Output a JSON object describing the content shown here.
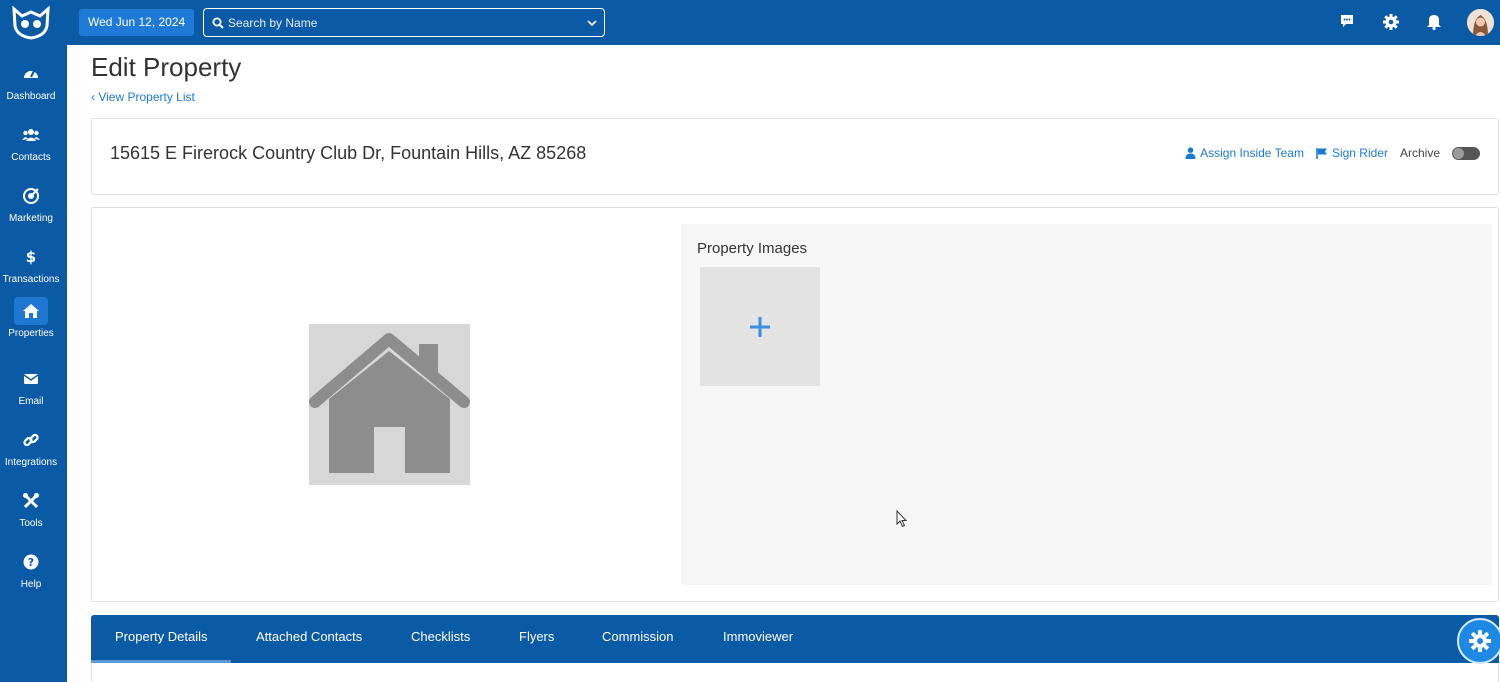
{
  "topbar": {
    "date": "Wed Jun 12, 2024",
    "search_placeholder": "Search by Name"
  },
  "sidebar": {
    "items": [
      {
        "label": "Dashboard",
        "icon": "dashboard-icon"
      },
      {
        "label": "Contacts",
        "icon": "contacts-icon"
      },
      {
        "label": "Marketing",
        "icon": "marketing-icon"
      },
      {
        "label": "Transactions",
        "icon": "dollar-icon"
      },
      {
        "label": "Properties",
        "icon": "home-icon",
        "active": true
      },
      {
        "label": "Email",
        "icon": "envelope-icon"
      },
      {
        "label": "Integrations",
        "icon": "link-icon"
      },
      {
        "label": "Tools",
        "icon": "tools-icon"
      },
      {
        "label": "Help",
        "icon": "help-icon"
      }
    ]
  },
  "page": {
    "title": "Edit Property",
    "back_link": "View Property List"
  },
  "property": {
    "address": "15615 E Firerock Country Club Dr, Fountain Hills, AZ 85268",
    "actions": {
      "assign_inside_team": "Assign Inside Team",
      "sign_rider": "Sign Rider",
      "archive": "Archive"
    },
    "archive_enabled": false
  },
  "images": {
    "title": "Property Images",
    "add_symbol": "+"
  },
  "tabs": [
    {
      "label": "Property Details",
      "active": true
    },
    {
      "label": "Attached Contacts"
    },
    {
      "label": "Checklists"
    },
    {
      "label": "Flyers"
    },
    {
      "label": "Commission"
    },
    {
      "label": "Immoviewer"
    }
  ],
  "colors": {
    "brand": "#0b5aa6",
    "link": "#1a7ad4",
    "accent": "#1f7ad6"
  }
}
